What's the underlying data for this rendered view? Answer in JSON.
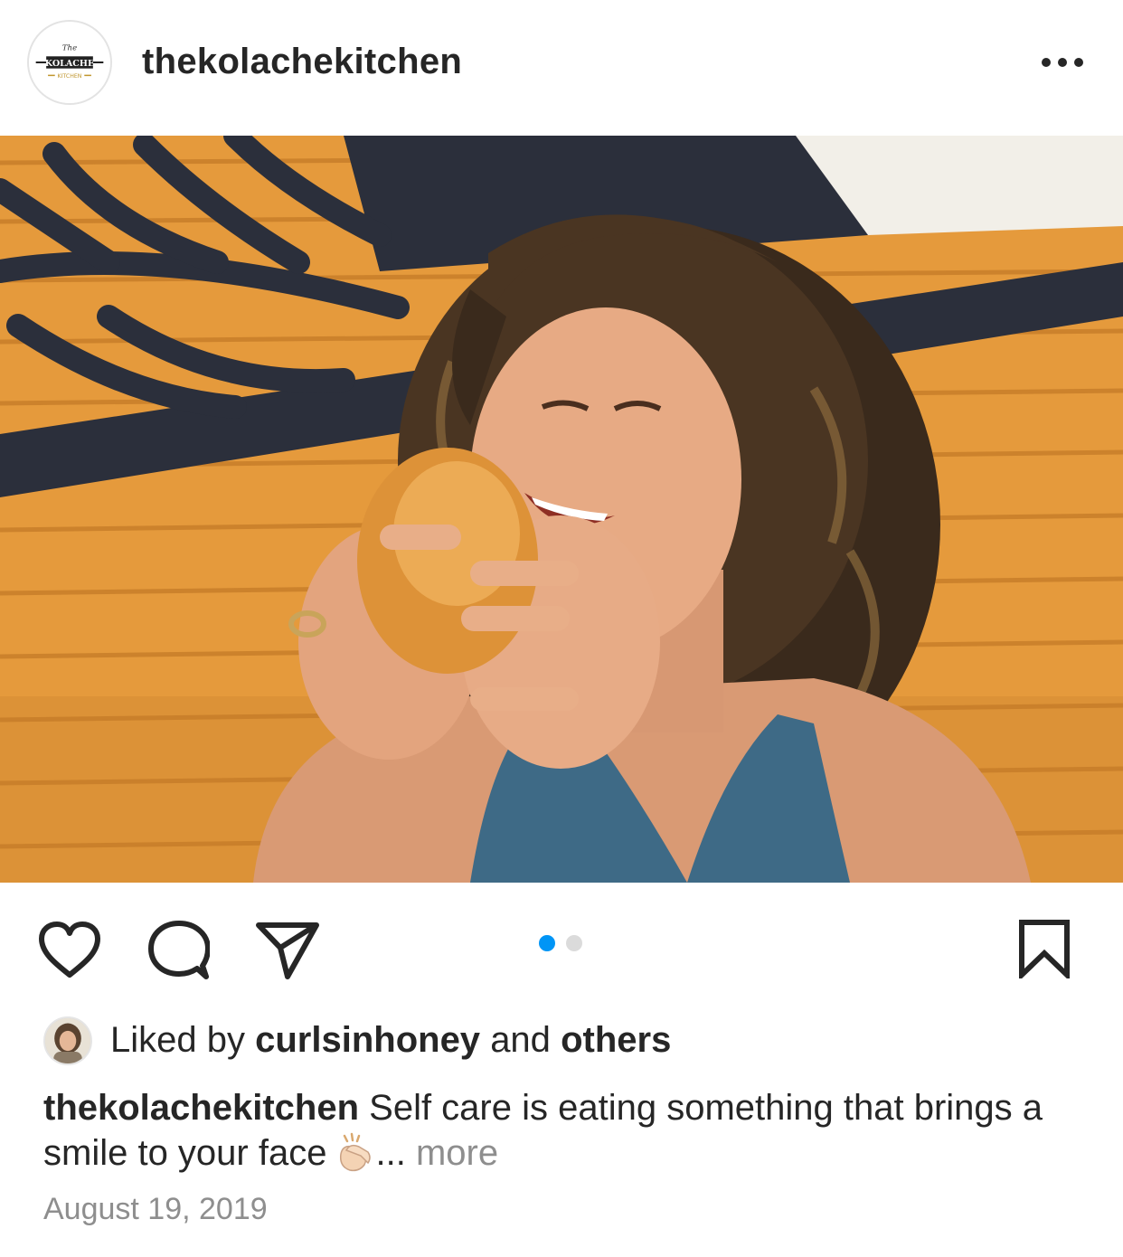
{
  "post": {
    "username": "thekolachekitchen",
    "avatar_icon": "kolache-kitchen-logo",
    "avatar_logo_text": {
      "top": "The",
      "middle": "KOLACHE",
      "bottom": "KITCHEN"
    },
    "more_icon": "more-horizontal-icon"
  },
  "media": {
    "description_icon": "photo",
    "carousel": {
      "count": 2,
      "active_index": 0
    }
  },
  "actions": {
    "like_icon": "heart-icon",
    "comment_icon": "comment-icon",
    "share_icon": "send-icon",
    "save_icon": "bookmark-icon"
  },
  "likes": {
    "prefix": "Liked by",
    "user": "curlsinhoney",
    "middle": "and",
    "suffix": "others"
  },
  "caption": {
    "username": "thekolachekitchen",
    "text": "Self care is eating something that brings a smile to your face",
    "emoji_icon": "clapping-hands-icon",
    "ellipsis": "...",
    "more": "more"
  },
  "date": "August 19, 2019",
  "colors": {
    "accent_blue": "#0095f6",
    "muted_gray": "#8e8e8e",
    "text_dark": "#262626",
    "wall_orange": "#e8a043",
    "mural_navy": "#2b2f3b"
  }
}
